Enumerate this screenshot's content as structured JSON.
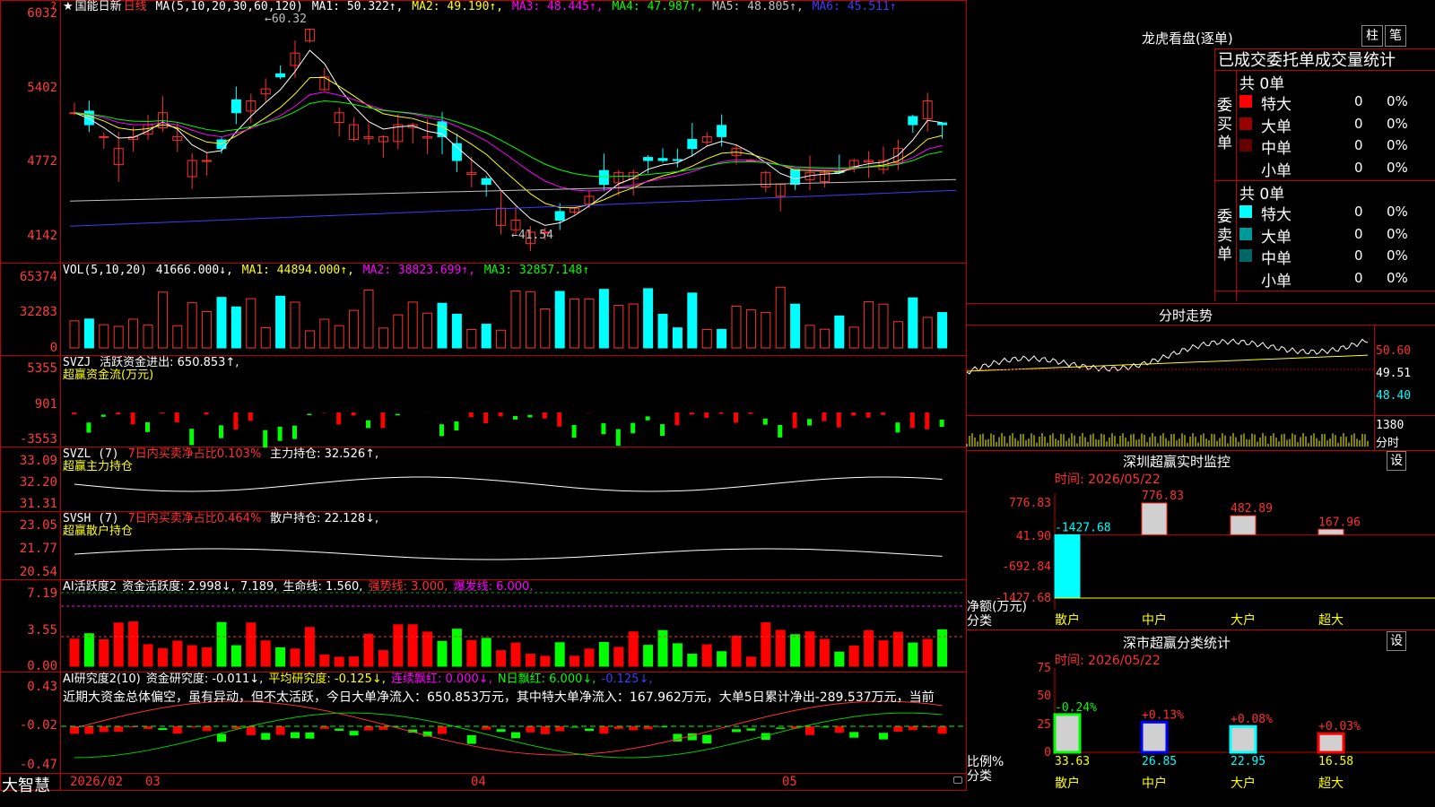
{
  "header": {
    "star": "★",
    "stock_name": "国能日新",
    "period": "日线",
    "ma_def": "MA(5,10,20,30,60,120)",
    "ma1": "MA1: 50.322↑,",
    "ma2": "MA2: 49.190↑,",
    "ma3": "MA3: 48.445↑,",
    "ma4": "MA4: 47.987↑,",
    "ma5": "MA5: 48.805↑,",
    "ma6": "MA6: 45.511↑",
    "high_marker": "←60.32",
    "low_marker": "←41.54",
    "corner_mark": "?"
  },
  "price_axis": [
    "6032",
    "5402",
    "4772",
    "4142"
  ],
  "vol": {
    "axis": [
      "65374",
      "32283",
      "0"
    ],
    "label": "VOL(5,10,20)",
    "val": "41666.000↓,",
    "ma1": "MA1: 44894.000↑,",
    "ma2": "MA2: 38823.699↑,",
    "ma3": "MA3: 32857.148↑"
  },
  "svzj": {
    "axis": [
      "5355",
      "901",
      "-3553"
    ],
    "label": "SVZJ",
    "text": "活跃资金进出: 650.853↑,",
    "sub": "超赢资金流(万元)"
  },
  "svzl": {
    "axis": [
      "33.09",
      "32.20",
      "31.31"
    ],
    "label": "SVZL (7)",
    "ratio": "7日内买卖净占比0.103%",
    "hold": "主力持仓: 32.526↑,",
    "sub": "超赢主力持仓"
  },
  "svsh": {
    "axis": [
      "23.05",
      "21.77",
      "20.54"
    ],
    "label": "SVSH (7)",
    "ratio": "7日内买卖净占比0.464%",
    "hold": "散户持仓: 22.128↓,",
    "sub": "超赢散户持仓"
  },
  "ai_act": {
    "axis": [
      "7.19",
      "3.55",
      "0.00"
    ],
    "label": "AI活跃度2",
    "deg": "资金活跃度: 2.998↓,",
    "v2": "7.189,",
    "life": "生命线: 1.560,",
    "strong": "强势线: 3.000,",
    "burst": "爆发线: 6.000,"
  },
  "ai_res": {
    "axis": [
      "0.43",
      "-0.02",
      "-0.47"
    ],
    "label": "AI研究度2(10)",
    "deg": "资金研究度: -0.011↓,",
    "avg": "平均研究度: -0.125↓,",
    "red": "连续飘红: 0.000↓,",
    "nred": "N日飘红: 6.000↓,",
    "last": "-0.125↓,",
    "summary": "近期大资金总体偏空，虽有异动，但不太活跃，今日大单净流入：650.853万元，其中特大单净流入：167.962万元，大单5日累计净出-289.537万元，当前"
  },
  "date_axis": [
    "2026/02",
    "03",
    "04",
    "05"
  ],
  "app_name": "大智慧",
  "lhb": {
    "title": "龙虎看盘(逐单)",
    "btn1": "柱",
    "btn2": "笔",
    "subtitle": "已成交委托单成交量统计",
    "buy_side": "委买单",
    "sell_side": "委卖单",
    "buy_total": "共 0单",
    "sell_total": "共 0单",
    "buy_rows": [
      {
        "name": "特大",
        "count": "0",
        "pct": "0%",
        "color": "#ff0000"
      },
      {
        "name": "大单",
        "count": "0",
        "pct": "0%",
        "color": "#990000"
      },
      {
        "name": "中单",
        "count": "0",
        "pct": "0%",
        "color": "#660000"
      },
      {
        "name": "小单",
        "count": "0",
        "pct": "0%",
        "color": "#000000"
      }
    ],
    "sell_rows": [
      {
        "name": "特大",
        "count": "0",
        "pct": "0%",
        "color": "#00ffff"
      },
      {
        "name": "大单",
        "count": "0",
        "pct": "0%",
        "color": "#009999"
      },
      {
        "name": "中单",
        "count": "0",
        "pct": "0%",
        "color": "#006666"
      },
      {
        "name": "小单",
        "count": "0",
        "pct": "0%",
        "color": "#000000"
      }
    ]
  },
  "intraday": {
    "title": "分时走势",
    "axis": [
      "50.60",
      "49.51",
      "48.40"
    ],
    "vol_axis": [
      "1380",
      "分时"
    ]
  },
  "sz_monitor": {
    "title": "深圳超赢实时监控",
    "btn": "设",
    "time": "时间: 2026/05/22",
    "axis": [
      "776.83",
      "41.90",
      "-692.84",
      "-1427.68"
    ],
    "ylabel": "净额(万元)",
    "xlabel_title": "分类",
    "chart_data": {
      "type": "bar",
      "categories": [
        "散户",
        "中户",
        "大户",
        "超大"
      ],
      "values": [
        -1427.68,
        776.83,
        482.89,
        167.96
      ],
      "labels": [
        "-1427.68",
        "776.83",
        "482.89",
        "167.96"
      ],
      "ylim": [
        -1427.68,
        776.83
      ]
    }
  },
  "sz_class": {
    "title": "深市超赢分类统计",
    "btn": "设",
    "time": "时间: 2026/05/22",
    "axis": [
      "75",
      "50",
      "25",
      "0"
    ],
    "ylabel": "比例%",
    "xlabel_title": "分类",
    "chart_data": {
      "type": "bar",
      "categories": [
        "散户",
        "中户",
        "大户",
        "超大"
      ],
      "values": [
        33.63,
        26.85,
        22.95,
        16.58
      ],
      "changes": [
        "-0.24%",
        "+0.13%",
        "+0.08%",
        "+0.03%"
      ],
      "ylim": [
        0,
        75
      ]
    }
  }
}
